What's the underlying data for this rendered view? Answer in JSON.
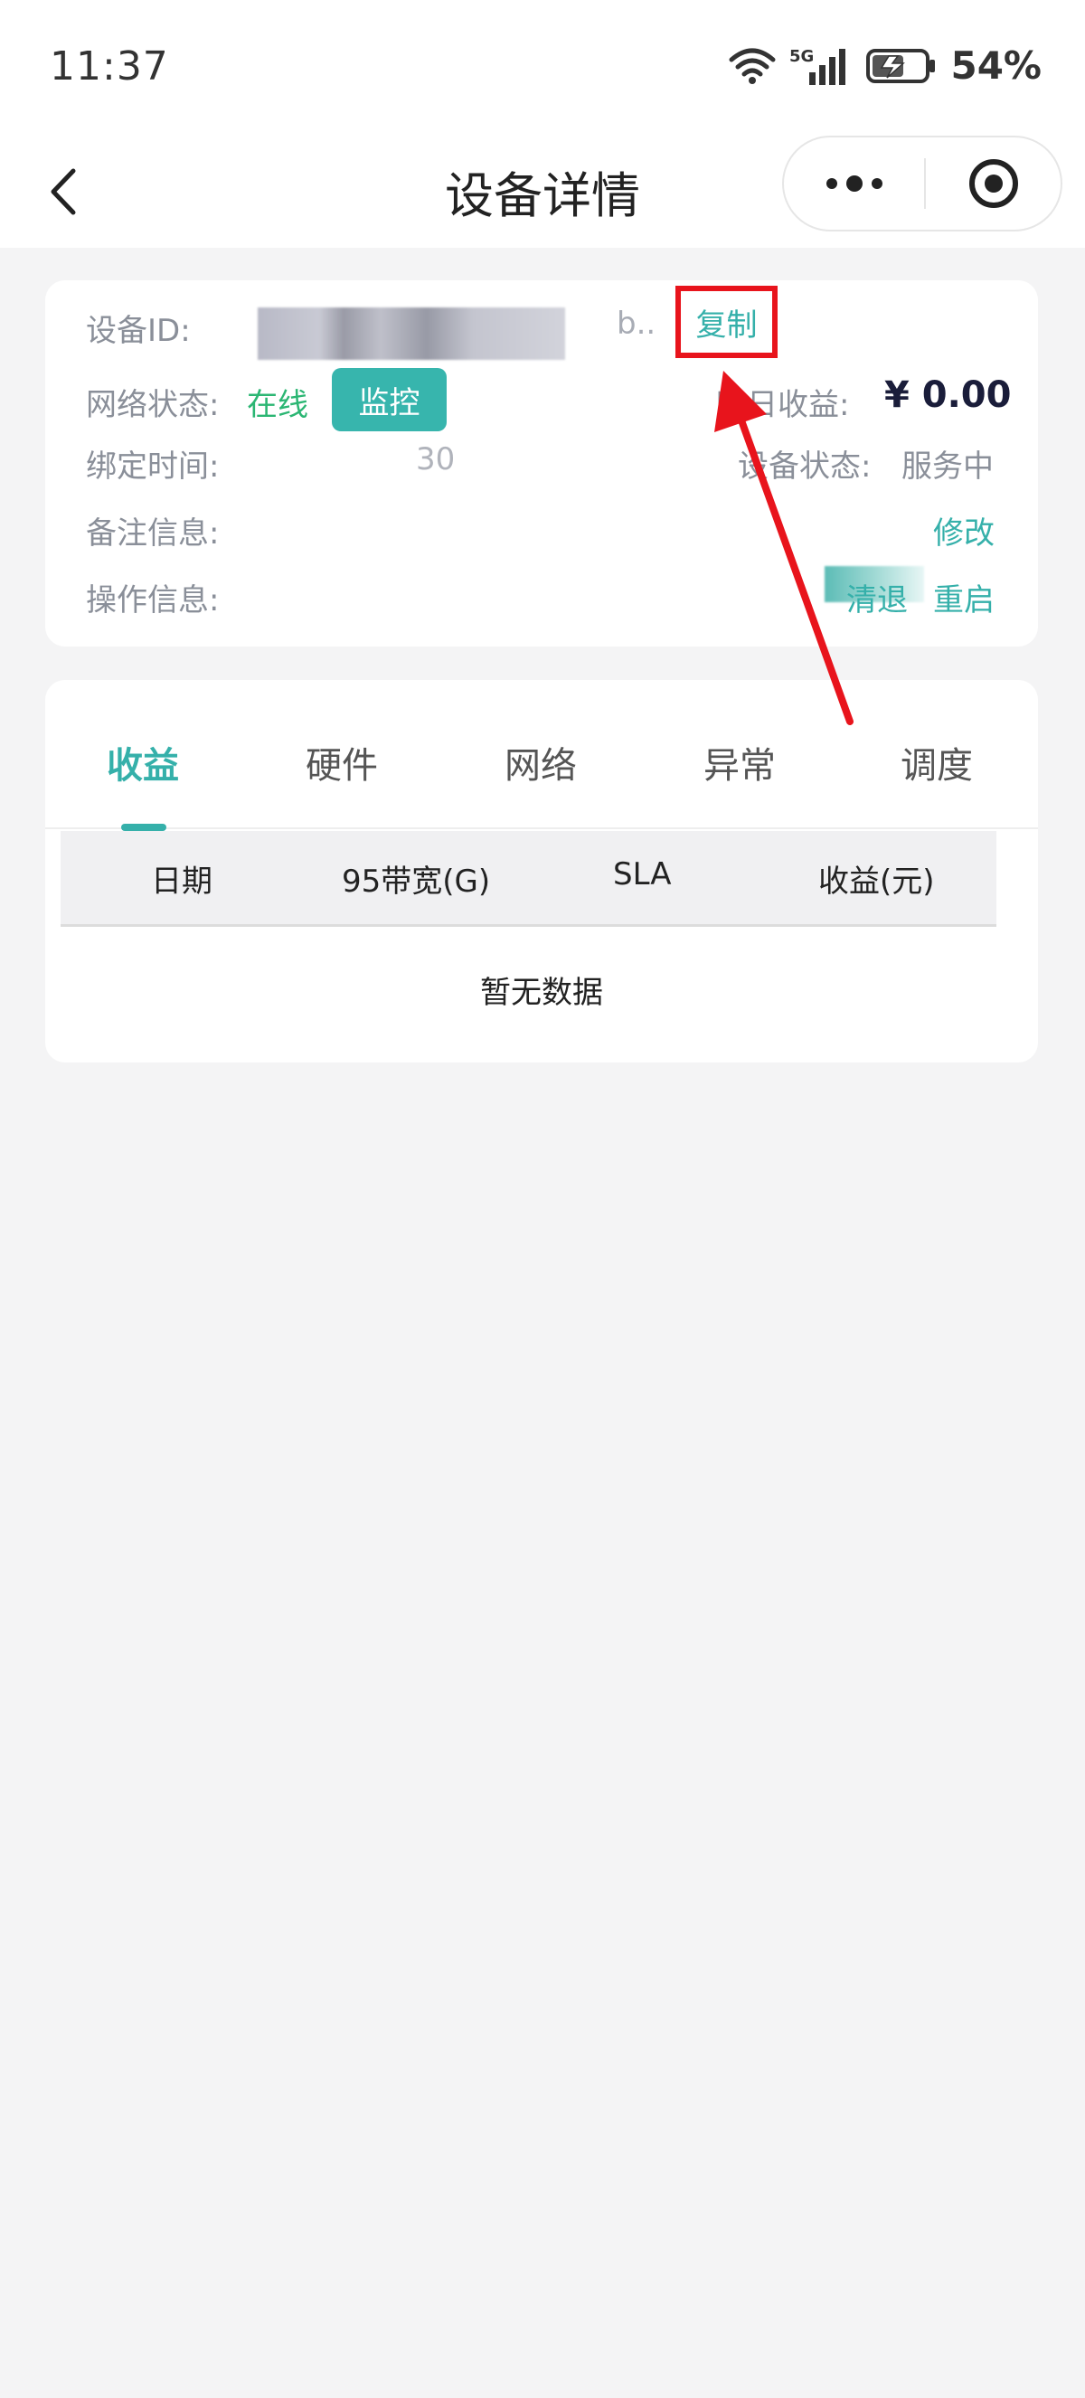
{
  "status_bar": {
    "time": "11:37",
    "network": "5G",
    "battery": "54%"
  },
  "nav": {
    "title": "设备详情",
    "icons": [
      "back-chevron-icon",
      "more-dots-icon",
      "close-target-icon"
    ]
  },
  "device": {
    "id_label": "设备ID:",
    "id_suffix": "b..",
    "copy_label": "复制",
    "network_label": "网络状态:",
    "network_value": "在线",
    "monitor_label": "监控",
    "yesterday_label": "昨日收益:",
    "yesterday_value": "¥ 0.00",
    "bind_time_label": "绑定时间:",
    "bind_time_value": "30",
    "device_status_label": "设备状态:",
    "device_status_value": "服务中",
    "remark_label": "备注信息:",
    "edit_label": "修改",
    "operation_label": "操作信息:",
    "clear_label": "清退",
    "restart_label": "重启"
  },
  "tabs": [
    "收益",
    "硬件",
    "网络",
    "异常",
    "调度"
  ],
  "active_tab": "收益",
  "table": {
    "columns": [
      "日期",
      "95带宽(G)",
      "SLA",
      "收益(元)"
    ],
    "empty_text": "暂无数据"
  },
  "colors": {
    "accent": "#35b0aa",
    "online": "#2bb673",
    "annotation": "#e8141c"
  }
}
